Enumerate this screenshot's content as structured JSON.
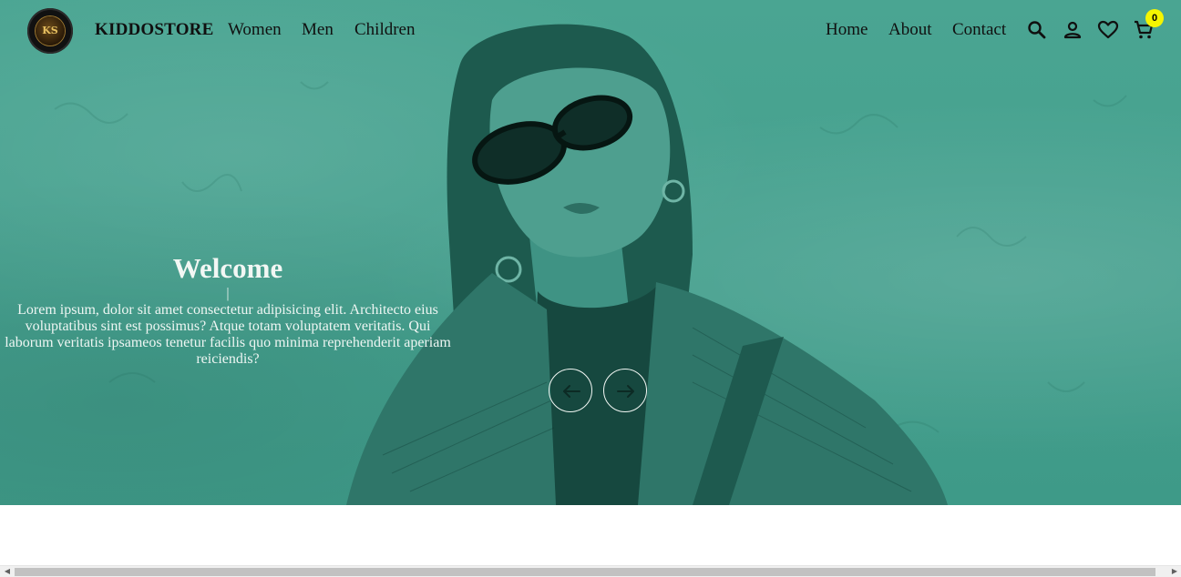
{
  "brand": {
    "name": "KIDDOSTORE",
    "logo_text": "KS"
  },
  "nav": {
    "left": [
      {
        "label": "Women"
      },
      {
        "label": "Men"
      },
      {
        "label": "Children"
      }
    ],
    "right": [
      {
        "label": "Home"
      },
      {
        "label": "About"
      },
      {
        "label": "Contact"
      }
    ],
    "icons": [
      "search-icon",
      "account-icon",
      "wishlist-heart-icon",
      "cart-icon"
    ],
    "cart_count": "0"
  },
  "hero": {
    "title": "Welcome",
    "separator": "|",
    "body": "Lorem ipsum, dolor sit amet consectetur adipisicing elit. Architecto eius voluptatibus sint est possimus? Atque totam voluptatem veritatis. Qui laborum veritatis ipsameos tenetur facilis quo minima reprehenderit aperiam reiciendis?",
    "overlay_color": "#45a08e",
    "controls": [
      "arrow-left-icon",
      "arrow-right-icon"
    ]
  },
  "colors": {
    "badge": "#f5f500",
    "nav_text": "#101010"
  }
}
